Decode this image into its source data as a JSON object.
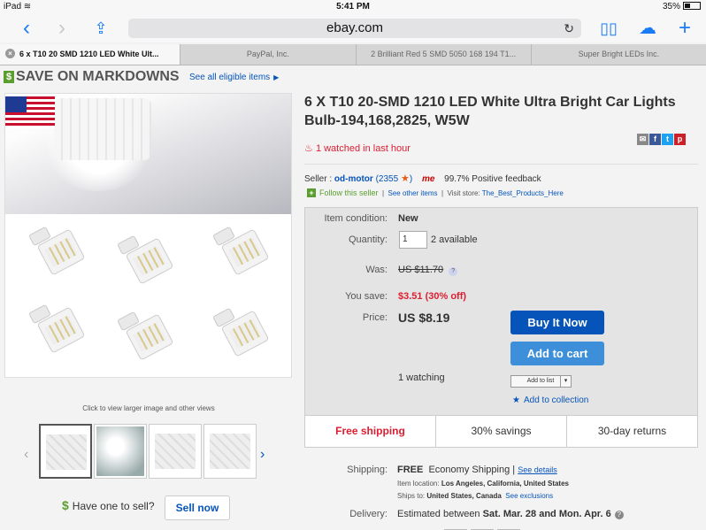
{
  "statusbar": {
    "device": "iPad",
    "time": "5:41 PM",
    "battery": "35%"
  },
  "browser": {
    "url": "ebay.com",
    "tabs": [
      {
        "label": "6 x T10 20 SMD 1210 LED White Ult...",
        "active": true
      },
      {
        "label": "PayPal, Inc."
      },
      {
        "label": "2 Brilliant Red 5 SMD 5050 168 194 T1..."
      },
      {
        "label": "Super Bright LEDs Inc."
      }
    ]
  },
  "promo": {
    "badge": "$",
    "headline": "SAVE ON MARKDOWNS",
    "link": "See all eligible items"
  },
  "gallery": {
    "caption": "Click to view larger image and other views"
  },
  "sell": {
    "badge": "$",
    "text": "Have one to sell?",
    "button": "Sell now"
  },
  "listing": {
    "title": "6 X T10 20-SMD 1210 LED White Ultra Bright Car Lights Bulb-194,168,2825, W5W",
    "watched": "1 watched in last hour"
  },
  "seller": {
    "prefix": "Seller :",
    "name": "od-motor",
    "score": "(2355",
    "score_close": ")",
    "badge": "me",
    "feedback": "99.7% Positive feedback",
    "follow": "Follow this seller",
    "see_other": "See other items",
    "visit_store_label": "Visit store:",
    "store": "The_Best_Products_Here"
  },
  "buybox": {
    "condition_label": "Item condition:",
    "condition": "New",
    "quantity_label": "Quantity:",
    "quantity": "1",
    "available": "2 available",
    "was_label": "Was:",
    "was": "US $11.70",
    "save_label": "You save:",
    "save": "$3.51 (30% off)",
    "price_label": "Price:",
    "price": "US $8.19",
    "buy_now": "Buy It Now",
    "add_to_cart": "Add to cart",
    "watching": "1 watching",
    "add_to_list": "Add to list",
    "add_to_collection": "Add to collection"
  },
  "features": [
    "Free shipping",
    "30% savings",
    "30-day returns"
  ],
  "shipping": {
    "label": "Shipping:",
    "free": "FREE",
    "method": "Economy Shipping",
    "see_details": "See details",
    "location_label": "Item location:",
    "location": "Los Angeles, California, United States",
    "ships_to_label": "Ships to:",
    "ships_to": "United States, Canada",
    "see_exclusions": "See exclusions",
    "delivery_label": "Delivery:",
    "delivery_prefix": "Estimated between",
    "delivery_dates": "Sat. Mar. 28 and Mon. Apr. 6"
  },
  "colors": {
    "link": "#0654ba",
    "buy_now": "#0654ba",
    "add_to_cart": "#3d8fd9",
    "alert_red": "#dd1e31",
    "safari_blue": "#1a7cf5"
  }
}
